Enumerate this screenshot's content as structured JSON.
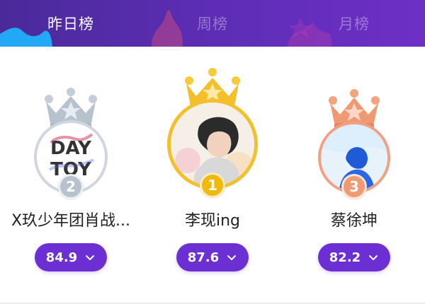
{
  "tabs": [
    {
      "label": "昨日榜",
      "active": true
    },
    {
      "label": "周榜",
      "active": false
    },
    {
      "label": "月榜",
      "active": false
    }
  ],
  "leaderboard": [
    {
      "rank": "2",
      "name": "X玖少年团肖战...",
      "score": "84.9",
      "medal": "silver",
      "avatar_text_1": "DAY",
      "avatar_text_2": "TOY"
    },
    {
      "rank": "1",
      "name": "李现ing",
      "score": "87.6",
      "medal": "gold"
    },
    {
      "rank": "3",
      "name": "蔡徐坤",
      "score": "82.2",
      "medal": "bronze"
    }
  ],
  "colors": {
    "header_left": "#4a2a9a",
    "header_right": "#6e2fc6",
    "button": "#6b2fd3",
    "silver": "#b8c2cc",
    "gold": "#f1b90f",
    "bronze": "#f09a73"
  },
  "icons": {
    "crown": "crown-icon",
    "chevron": "chevron-down-icon"
  }
}
